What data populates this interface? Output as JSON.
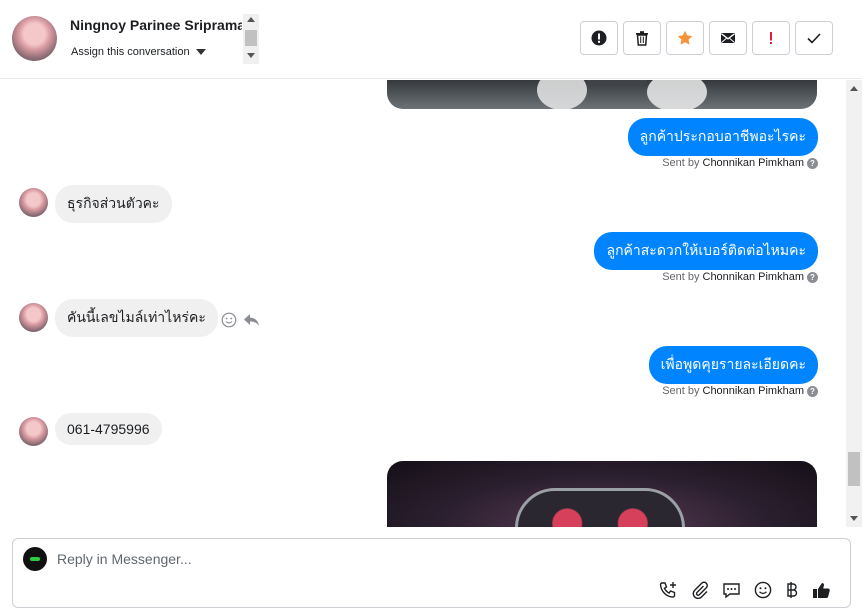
{
  "header": {
    "contact_name": "Ningnoy Parinee Sripramai",
    "assign_label": "Assign this conversation",
    "actions": [
      {
        "name": "mark-spam-button",
        "icon": "exclamation-circle-icon"
      },
      {
        "name": "delete-button",
        "icon": "trash-icon"
      },
      {
        "name": "star-button",
        "icon": "star-icon",
        "color": "#f7923b"
      },
      {
        "name": "mark-unread-button",
        "icon": "envelope-icon"
      },
      {
        "name": "follow-up-button",
        "icon": "exclamation-icon",
        "color": "#e41e3f"
      },
      {
        "name": "mark-done-button",
        "icon": "check-icon"
      }
    ]
  },
  "messages": [
    {
      "direction": "out",
      "type": "image",
      "desc": "car-interior-photo"
    },
    {
      "direction": "out",
      "text": "ลูกค้าประกอบอาชีพอะไรคะ",
      "sent_by_prefix": "Sent by",
      "sent_by": "Chonnikan Pimkham"
    },
    {
      "direction": "in",
      "text": "ธุรกิจส่วนตัวคะ"
    },
    {
      "direction": "out",
      "text": "ลูกค้าสะดวกให้เบอร์ติดต่อไหมคะ",
      "sent_by_prefix": "Sent by",
      "sent_by": "Chonnikan Pimkham"
    },
    {
      "direction": "in",
      "text": "คันนี้เลขไมล์เท่าไหร่คะ"
    },
    {
      "direction": "out",
      "text": "เพื่อพูดคุยรายละเอียดคะ",
      "sent_by_prefix": "Sent by",
      "sent_by": "Chonnikan Pimkham"
    },
    {
      "direction": "in",
      "text": "061-4795996"
    },
    {
      "direction": "out",
      "type": "image",
      "desc": "dashboard-gauge-photo"
    }
  ],
  "composer": {
    "placeholder": "Reply in Messenger...",
    "tools": [
      "call-icon",
      "attachment-icon",
      "saved-reply-icon",
      "emoji-icon",
      "baht-icon",
      "thumbs-up-icon"
    ]
  },
  "colors": {
    "outgoing_bubble": "#0084ff",
    "incoming_bubble": "#f0f0f0"
  }
}
